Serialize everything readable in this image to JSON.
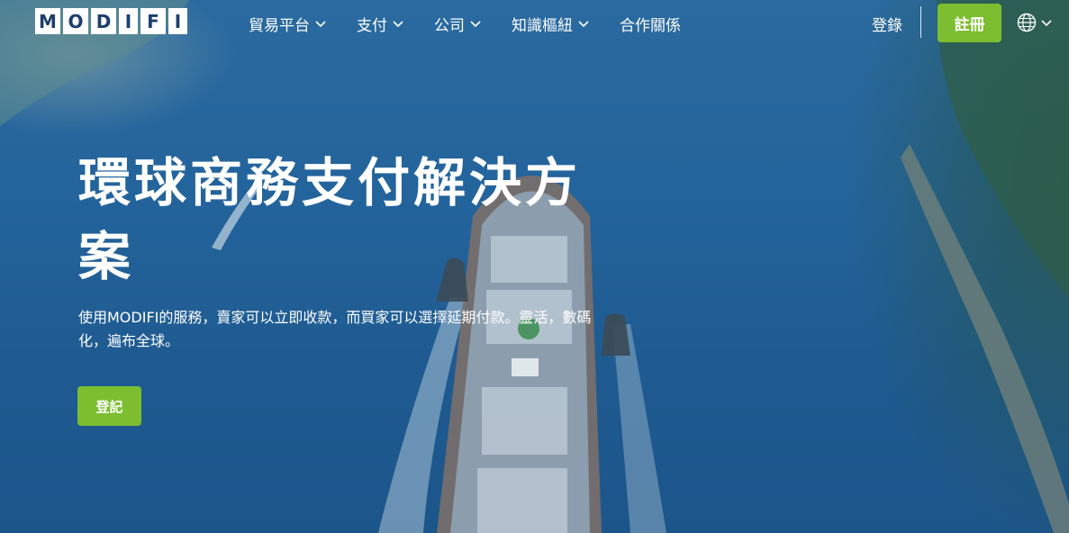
{
  "brand": {
    "logo_letters": [
      "M",
      "O",
      "D",
      "I",
      "F",
      "I"
    ]
  },
  "nav": {
    "items": [
      {
        "label": "貿易平台",
        "has_dropdown": true
      },
      {
        "label": "支付",
        "has_dropdown": true
      },
      {
        "label": "公司",
        "has_dropdown": true
      },
      {
        "label": "知識樞紐",
        "has_dropdown": true
      },
      {
        "label": "合作關係",
        "has_dropdown": false
      }
    ],
    "login_label": "登錄",
    "signup_label": "註冊",
    "language_icon": "globe-icon"
  },
  "hero": {
    "title": "環球商務支付解決方案",
    "description": "使用MODIFI的服務，賣家可以立即收款，而買家可以選擇延期付款。靈活，數碼化，遍布全球。",
    "cta_label": "登記"
  },
  "colors": {
    "accent_green": "#7cbe30",
    "logo_blue": "#1c3e6e",
    "text": "#ffffff"
  }
}
